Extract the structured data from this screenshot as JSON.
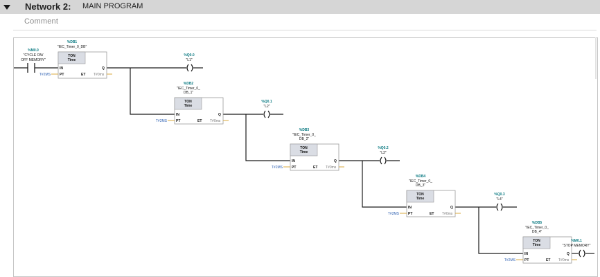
{
  "network": {
    "label": "Network 2:",
    "name": "MAIN PROGRAM"
  },
  "comment_placeholder": "Comment",
  "contact": {
    "address": "%M0.0",
    "tag_line1": "\"CYCLE ON/",
    "tag_line2": "OFF MEMORY\""
  },
  "timers": [
    {
      "db": "%DB1",
      "instance": [
        "\"IEC_Timer_0_DB\""
      ],
      "type": "TON",
      "base": "Time",
      "pin_in": "IN",
      "pin_q": "Q",
      "pin_pt": "PT",
      "pin_et": "ET",
      "pt_value": "T#2MS",
      "et_value": "T#0ms"
    },
    {
      "db": "%DB2",
      "instance": [
        "\"IEC_Timer_0_",
        "DB_1\""
      ],
      "type": "TON",
      "base": "Time",
      "pin_in": "IN",
      "pin_q": "Q",
      "pin_pt": "PT",
      "pin_et": "ET",
      "pt_value": "T#2MS",
      "et_value": "T#0ms"
    },
    {
      "db": "%DB3",
      "instance": [
        "\"IEC_Timer_0_",
        "DB_2\""
      ],
      "type": "TON",
      "base": "Time",
      "pin_in": "IN",
      "pin_q": "Q",
      "pin_pt": "PT",
      "pin_et": "ET",
      "pt_value": "T#2MS",
      "et_value": "T#0ms"
    },
    {
      "db": "%DB4",
      "instance": [
        "\"IEC_Timer_0_",
        "DB_3\""
      ],
      "type": "TON",
      "base": "Time",
      "pin_in": "IN",
      "pin_q": "Q",
      "pin_pt": "PT",
      "pin_et": "ET",
      "pt_value": "T#2MS",
      "et_value": "T#0ms"
    },
    {
      "db": "%DB5",
      "instance": [
        "\"IEC_Timer_0_",
        "DB_4\""
      ],
      "type": "TON",
      "base": "Time",
      "pin_in": "IN",
      "pin_q": "Q",
      "pin_pt": "PT",
      "pin_et": "ET",
      "pt_value": "T#2MS",
      "et_value": "T#0ms"
    }
  ],
  "coils": [
    {
      "address": "%Q0.0",
      "tag": "\"L1\""
    },
    {
      "address": "%Q0.1",
      "tag": "\"L2\""
    },
    {
      "address": "%Q0.2",
      "tag": "\"L3\""
    },
    {
      "address": "%Q0.3",
      "tag": "\"L4\""
    },
    {
      "address": "%M0.1",
      "tag": "\"STOP MEMORY\""
    }
  ]
}
